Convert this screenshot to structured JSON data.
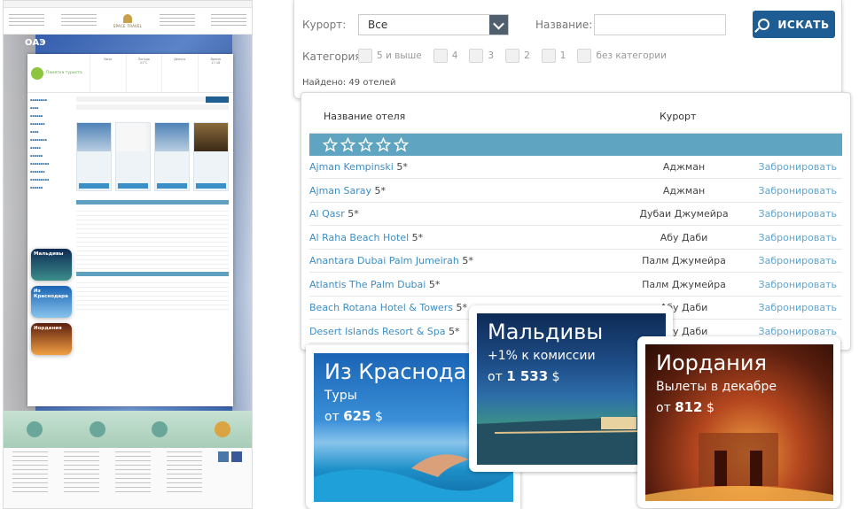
{
  "thumbnail": {
    "page_title": "ОАЭ",
    "logo_text": "SPACE TRAVEL",
    "tip_label": "Памятка туриста",
    "weather": [
      "Виза",
      "Погода",
      "Деньги",
      "Время"
    ],
    "temperature": "21°C",
    "clock": "17:18",
    "promos": [
      "Мальдивы",
      "Из Краснодара",
      "Иордания"
    ]
  },
  "search": {
    "resort_label": "Курорт:",
    "resort_value": "Все",
    "name_label": "Название:",
    "name_value": "",
    "search_button": "ИСКАТЬ",
    "category_label": "Категория:",
    "categories": [
      "5 и выше",
      "4",
      "3",
      "2",
      "1",
      "без категории"
    ],
    "found_text": "Найдено: 49 отелей"
  },
  "results": {
    "col_hotel": "Название отеля",
    "col_resort": "Курорт",
    "rows": [
      {
        "name": "Ajman Kempinski",
        "stars": "5*",
        "resort": "Аджман",
        "action": "Забронировать"
      },
      {
        "name": "Ajman Saray",
        "stars": "5*",
        "resort": "Аджман",
        "action": "Забронировать"
      },
      {
        "name": "Al Qasr",
        "stars": "5*",
        "resort": "Дубаи Джумейра",
        "action": "Забронировать"
      },
      {
        "name": "Al Raha Beach Hotel",
        "stars": "5*",
        "resort": "Абу Даби",
        "action": "Забронировать"
      },
      {
        "name": "Anantara Dubai Palm Jumeirah",
        "stars": "5*",
        "resort": "Палм Джумейра",
        "action": "Забронировать"
      },
      {
        "name": "Atlantis The Palm Dubai",
        "stars": "5*",
        "resort": "Палм Джумейра",
        "action": "Забронировать"
      },
      {
        "name": "Beach Rotana Hotel & Towers",
        "stars": "5*",
        "resort": "Абу Даби",
        "action": "Забронировать"
      },
      {
        "name": "Desert Islands Resort & Spa",
        "stars": "5*",
        "resort": "Абу Даби",
        "action": "Забронировать"
      }
    ]
  },
  "promos": {
    "krasnodar": {
      "title": "Из Краснода",
      "subtitle": "Туры",
      "price_prefix": "от",
      "price": "625",
      "currency": "$"
    },
    "maldives": {
      "title": "Мальдивы",
      "subtitle": "+1% к комиссии",
      "price_prefix": "от",
      "price": "1 533",
      "currency": "$"
    },
    "jordan": {
      "title": "Иордания",
      "subtitle": "Вылеты в декабре",
      "price_prefix": "от",
      "price": "812",
      "currency": "$"
    }
  },
  "colors": {
    "primary": "#1e5d93",
    "stars_bar": "#5fa5c2",
    "link": "#3c8ec6"
  }
}
